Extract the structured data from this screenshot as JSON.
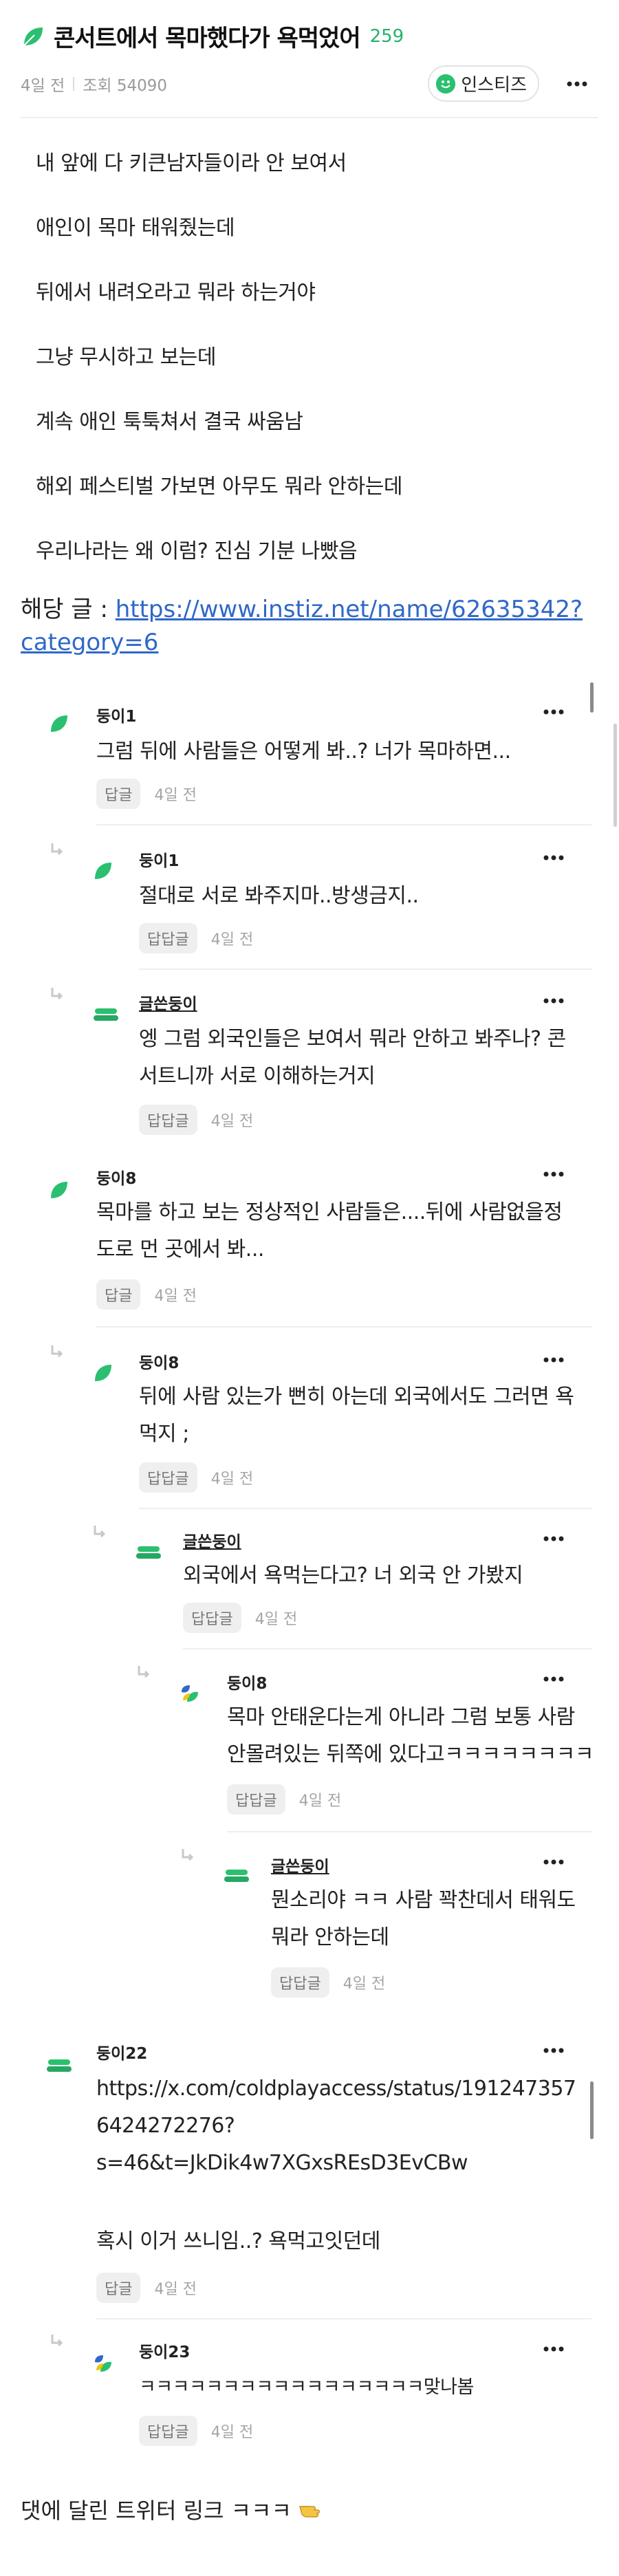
{
  "post": {
    "title": "콘서트에서 목마했다가 욕먹었어",
    "comment_count": "259",
    "time": "4일 전",
    "views": "조회 54090",
    "site_badge": "인스티즈",
    "body_lines": [
      "내 앞에 다 키큰남자들이라 안 보여서",
      "애인이 목마 태워줬는데",
      "뒤에서 내려오라고 뭐라 하는거야",
      "그냥 무시하고 보는데",
      "계속 애인 툭툭쳐서 결국 싸움남",
      "해외 페스티벌 가보면 아무도 뭐라 안하는데",
      "우리나라는 왜 이럼? 진심 기분 나빴음"
    ],
    "source_prefix": "해당 글 : ",
    "source_url": "https://www.instiz.net/name/62635342?category=6",
    "source_url_line1": "https://www.instiz.net/name/62635342?",
    "source_url_line2": "category=6"
  },
  "comments": [
    {
      "name": "둥이1",
      "lines": [
        "그럼 뒤에 사람들은 어떻게 봐..? 너가 목마하면..."
      ],
      "reply_label": "답글",
      "time": "4일 전"
    },
    {
      "name": "둥이1",
      "lines": [
        "절대로 서로 봐주지마..방생금지.."
      ],
      "reply_label": "답답글",
      "time": "4일 전"
    },
    {
      "name": "글쓴둥이",
      "lines": [
        "엥 그럼 외국인들은 보여서 뭐라 안하고 봐주나? 콘",
        "서트니까 서로 이해하는거지"
      ],
      "reply_label": "답답글",
      "time": "4일 전"
    },
    {
      "name": "둥이8",
      "lines": [
        "목마를 하고 보는 정상적인 사람들은....뒤에 사람없을정",
        "도로 먼 곳에서 봐..."
      ],
      "reply_label": "답글",
      "time": "4일 전"
    },
    {
      "name": "둥이8",
      "lines": [
        "뒤에 사람 있는가 뻔히 아는데 외국에서도 그러면 욕",
        "먹지 ;"
      ],
      "reply_label": "답답글",
      "time": "4일 전"
    },
    {
      "name": "글쓴둥이",
      "lines": [
        "외국에서 욕먹는다고? 너 외국 안 가봤지"
      ],
      "reply_label": "답답글",
      "time": "4일 전"
    },
    {
      "name": "둥이8",
      "lines": [
        "목마 안태운다는게 아니라 그럼 보통 사람",
        "안몰려있는 뒤쪽에 있다고ㅋㅋㅋㅋㅋㅋㅋㅋ"
      ],
      "reply_label": "답답글",
      "time": "4일 전"
    },
    {
      "name": "글쓴둥이",
      "lines": [
        "뭔소리야 ㅋㅋ 사람 꽉찬데서 태워도",
        "뭐라 안하는데"
      ],
      "reply_label": "답답글",
      "time": "4일 전"
    },
    {
      "name": "둥이22",
      "lines": [
        "https://x.com/coldplayaccess/status/191247357",
        "6424272276?",
        "s=46&t=JkDik4w7XGxsREsD3EvCBw",
        "",
        "혹시 이거 쓰니임..? 욕먹고잇던데"
      ],
      "reply_label": "답글",
      "time": "4일 전"
    },
    {
      "name": "둥이23",
      "lines": [
        "ㅋㅋㅋㅋㅋㅋㅋㅋㅋㅋㅋㅋㅋㅋㅋㅋㅋ맞나봄"
      ],
      "reply_label": "답답글",
      "time": "4일 전"
    }
  ],
  "footer_text": "댓에 달린 트위터 링크 ㅋㅋㅋ",
  "colors": {
    "accent_green": "#22b36b",
    "link_blue": "#2f68c7",
    "muted": "#9a9a9a"
  },
  "icons": {
    "title": "leaf-icon",
    "badge": "smile-icon",
    "more": "more-dots-icon",
    "reply": "reply-arrow-icon",
    "footer": "pointing-hand-icon"
  }
}
